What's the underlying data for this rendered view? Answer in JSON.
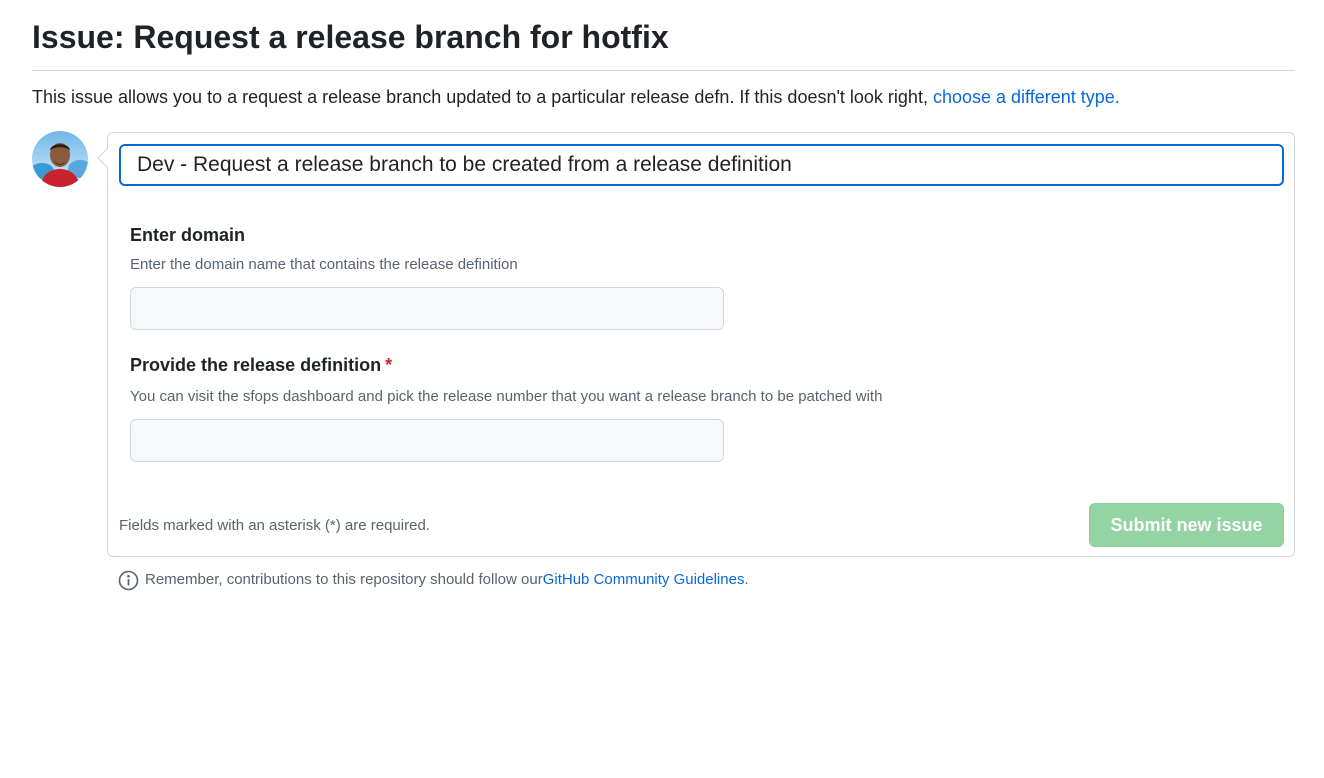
{
  "page": {
    "title": "Issue: Request a release branch for hotfix"
  },
  "intro": {
    "text": "This issue allows you to a request a release branch updated to a particular release defn. If this doesn't look right, ",
    "link_label": "choose a different type."
  },
  "avatar": {
    "icon": "user-avatar"
  },
  "form": {
    "title_value": "Dev - Request a release branch to be created from a release definition",
    "fields": [
      {
        "label": "Enter domain",
        "help": "Enter the domain name that contains the release definition",
        "value": "",
        "required": false
      },
      {
        "label": "Provide the release definition",
        "required_mark": "*",
        "help": "You can visit the sfops dashboard and pick the release number that you want a release branch to be patched with",
        "value": "",
        "required": true
      }
    ],
    "footer_note": "Fields marked with an asterisk (*) are required.",
    "submit_label": "Submit new issue"
  },
  "reminder": {
    "text": "Remember, contributions to this repository should follow our ",
    "link_label": "GitHub Community Guidelines",
    "suffix": ".",
    "icon": "info-icon"
  },
  "colors": {
    "link": "#0969da",
    "focus_border": "#0969da",
    "submit_disabled_bg": "#94d3a2",
    "required_mark": "#cf222e"
  }
}
